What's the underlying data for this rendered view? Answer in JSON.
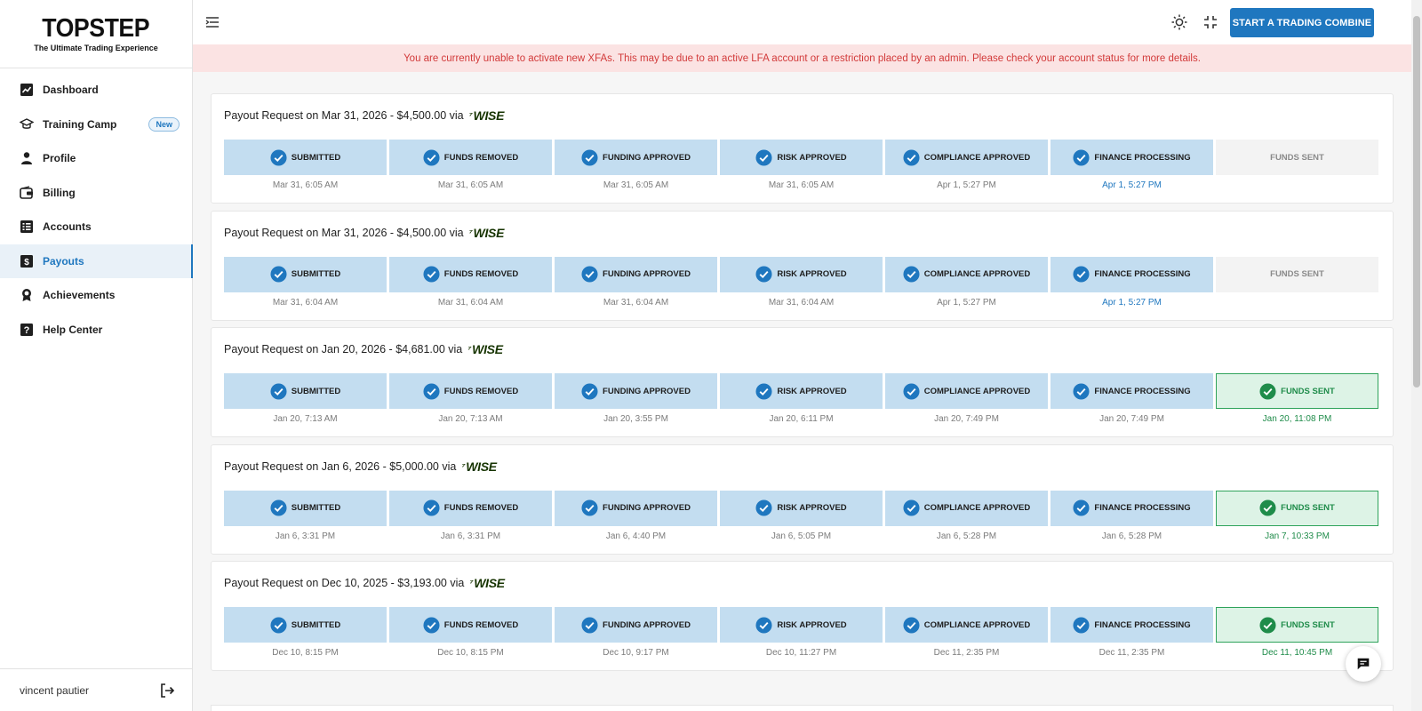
{
  "brand": {
    "title": "TOPSTEP",
    "tagline": "The Ultimate Trading Experience"
  },
  "sidebar": {
    "items": [
      {
        "label": "Dashboard",
        "icon": "chart-line-icon"
      },
      {
        "label": "Training Camp",
        "icon": "graduation-cap-icon",
        "badge": "New"
      },
      {
        "label": "Profile",
        "icon": "person-icon"
      },
      {
        "label": "Billing",
        "icon": "wallet-icon"
      },
      {
        "label": "Accounts",
        "icon": "list-icon"
      },
      {
        "label": "Payouts",
        "icon": "dollar-icon",
        "active": true
      },
      {
        "label": "Achievements",
        "icon": "award-icon"
      },
      {
        "label": "Help Center",
        "icon": "help-icon"
      }
    ],
    "user": {
      "name": "vincent pautier"
    }
  },
  "header": {
    "cta_label": "START A TRADING COMBINE"
  },
  "alert": {
    "text": "You are currently unable to activate new XFAs. This may be due to an active LFA account or a restriction placed by an admin. Please check your account status for more details."
  },
  "payouts": {
    "via_label": "WISE",
    "requests": [
      {
        "title": "Payout Request on Mar 31, 2026 - $4,500.00 via",
        "steps": [
          {
            "label": "SUBMITTED",
            "time": "Mar 31, 6:05 AM",
            "state": "done"
          },
          {
            "label": "FUNDS REMOVED",
            "time": "Mar 31, 6:05 AM",
            "state": "done"
          },
          {
            "label": "FUNDING APPROVED",
            "time": "Mar 31, 6:05 AM",
            "state": "done"
          },
          {
            "label": "RISK APPROVED",
            "time": "Mar 31, 6:05 AM",
            "state": "done"
          },
          {
            "label": "COMPLIANCE APPROVED",
            "time": "Apr 1, 5:27 PM",
            "state": "done"
          },
          {
            "label": "FINANCE PROCESSING",
            "time": "Apr 1, 5:27 PM",
            "state": "current"
          },
          {
            "label": "FUNDS SENT",
            "time": "",
            "state": "pending"
          }
        ]
      },
      {
        "title": "Payout Request on Mar 31, 2026 - $4,500.00 via",
        "steps": [
          {
            "label": "SUBMITTED",
            "time": "Mar 31, 6:04 AM",
            "state": "done"
          },
          {
            "label": "FUNDS REMOVED",
            "time": "Mar 31, 6:04 AM",
            "state": "done"
          },
          {
            "label": "FUNDING APPROVED",
            "time": "Mar 31, 6:04 AM",
            "state": "done"
          },
          {
            "label": "RISK APPROVED",
            "time": "Mar 31, 6:04 AM",
            "state": "done"
          },
          {
            "label": "COMPLIANCE APPROVED",
            "time": "Apr 1, 5:27 PM",
            "state": "done"
          },
          {
            "label": "FINANCE PROCESSING",
            "time": "Apr 1, 5:27 PM",
            "state": "current"
          },
          {
            "label": "FUNDS SENT",
            "time": "",
            "state": "pending"
          }
        ]
      },
      {
        "title": "Payout Request on Jan 20, 2026 - $4,681.00 via",
        "steps": [
          {
            "label": "SUBMITTED",
            "time": "Jan 20, 7:13 AM",
            "state": "done"
          },
          {
            "label": "FUNDS REMOVED",
            "time": "Jan 20, 7:13 AM",
            "state": "done"
          },
          {
            "label": "FUNDING APPROVED",
            "time": "Jan 20, 3:55 PM",
            "state": "done"
          },
          {
            "label": "RISK APPROVED",
            "time": "Jan 20, 6:11 PM",
            "state": "done"
          },
          {
            "label": "COMPLIANCE APPROVED",
            "time": "Jan 20, 7:49 PM",
            "state": "done"
          },
          {
            "label": "FINANCE PROCESSING",
            "time": "Jan 20, 7:49 PM",
            "state": "done"
          },
          {
            "label": "FUNDS SENT",
            "time": "Jan 20, 11:08 PM",
            "state": "sent"
          }
        ]
      },
      {
        "title": "Payout Request on Jan 6, 2026 - $5,000.00 via",
        "steps": [
          {
            "label": "SUBMITTED",
            "time": "Jan 6, 3:31 PM",
            "state": "done"
          },
          {
            "label": "FUNDS REMOVED",
            "time": "Jan 6, 3:31 PM",
            "state": "done"
          },
          {
            "label": "FUNDING APPROVED",
            "time": "Jan 6, 4:40 PM",
            "state": "done"
          },
          {
            "label": "RISK APPROVED",
            "time": "Jan 6, 5:05 PM",
            "state": "done"
          },
          {
            "label": "COMPLIANCE APPROVED",
            "time": "Jan 6, 5:28 PM",
            "state": "done"
          },
          {
            "label": "FINANCE PROCESSING",
            "time": "Jan 6, 5:28 PM",
            "state": "done"
          },
          {
            "label": "FUNDS SENT",
            "time": "Jan 7, 10:33 PM",
            "state": "sent"
          }
        ]
      },
      {
        "title": "Payout Request on Dec 10, 2025 - $3,193.00 via",
        "steps": [
          {
            "label": "SUBMITTED",
            "time": "Dec 10, 8:15 PM",
            "state": "done"
          },
          {
            "label": "FUNDS REMOVED",
            "time": "Dec 10, 8:15 PM",
            "state": "done"
          },
          {
            "label": "FUNDING APPROVED",
            "time": "Dec 10, 9:17 PM",
            "state": "done"
          },
          {
            "label": "RISK APPROVED",
            "time": "Dec 10, 11:27 PM",
            "state": "done"
          },
          {
            "label": "COMPLIANCE APPROVED",
            "time": "Dec 11, 2:35 PM",
            "state": "done"
          },
          {
            "label": "FINANCE PROCESSING",
            "time": "Dec 11, 2:35 PM",
            "state": "done"
          },
          {
            "label": "FUNDS SENT",
            "time": "Dec 11, 10:45 PM",
            "state": "sent"
          }
        ]
      }
    ]
  },
  "colors": {
    "accent": "#1f77bf",
    "done_bg": "#c3ddf0",
    "sent_bg": "#ddf3e6",
    "sent_green": "#2fa35b",
    "alert_bg": "#fbe3e3",
    "alert_text": "#d23a3a"
  }
}
